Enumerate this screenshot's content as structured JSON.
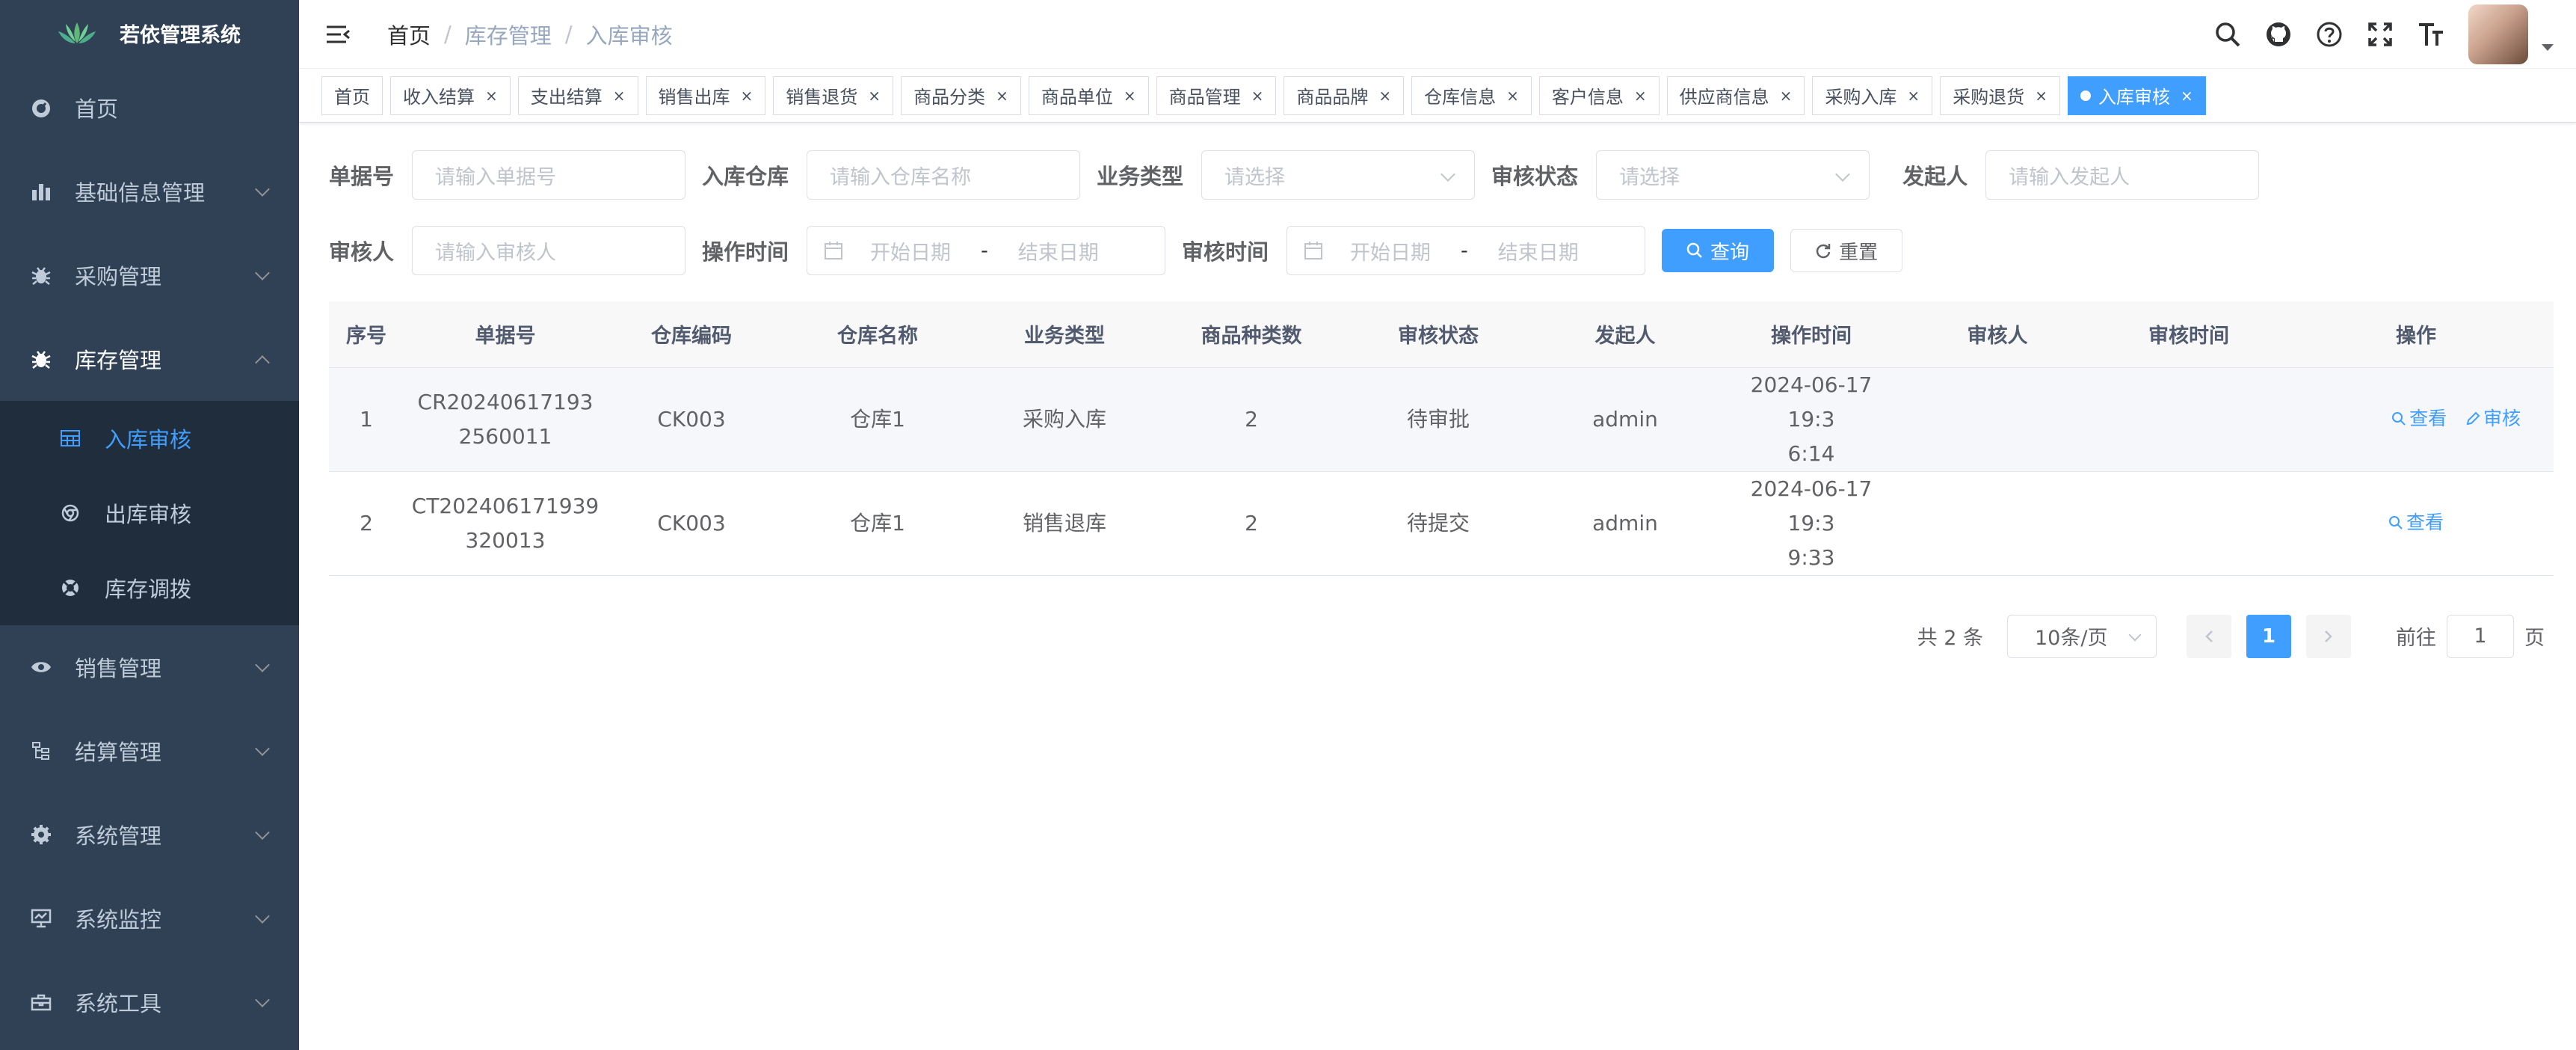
{
  "app": {
    "title": "若依管理系统"
  },
  "sidebar": {
    "items": [
      {
        "label": "首页",
        "icon": "dashboard-icon"
      },
      {
        "label": "基础信息管理",
        "icon": "chart-icon"
      },
      {
        "label": "采购管理",
        "icon": "bug-icon"
      },
      {
        "label": "库存管理",
        "icon": "bug-icon"
      },
      {
        "label": "销售管理",
        "icon": "eye-icon"
      },
      {
        "label": "结算管理",
        "icon": "tree-icon"
      },
      {
        "label": "系统管理",
        "icon": "gear-icon"
      },
      {
        "label": "系统监控",
        "icon": "monitor-icon"
      },
      {
        "label": "系统工具",
        "icon": "toolbox-icon"
      }
    ],
    "submenu": [
      {
        "label": "入库审核",
        "icon": "table-icon"
      },
      {
        "label": "出库审核",
        "icon": "chrome-icon"
      },
      {
        "label": "库存调拨",
        "icon": "lifebuoy-icon"
      }
    ]
  },
  "breadcrumb": {
    "home": "首页",
    "level1": "库存管理",
    "level2": "入库审核",
    "sep": "/"
  },
  "tags": [
    {
      "label": "首页",
      "closable": false
    },
    {
      "label": "收入结算",
      "closable": true
    },
    {
      "label": "支出结算",
      "closable": true
    },
    {
      "label": "销售出库",
      "closable": true
    },
    {
      "label": "销售退货",
      "closable": true
    },
    {
      "label": "商品分类",
      "closable": true
    },
    {
      "label": "商品单位",
      "closable": true
    },
    {
      "label": "商品管理",
      "closable": true
    },
    {
      "label": "商品品牌",
      "closable": true
    },
    {
      "label": "仓库信息",
      "closable": true
    },
    {
      "label": "客户信息",
      "closable": true
    },
    {
      "label": "供应商信息",
      "closable": true
    },
    {
      "label": "采购入库",
      "closable": true
    },
    {
      "label": "采购退货",
      "closable": true
    },
    {
      "label": "入库审核",
      "closable": true,
      "active": true
    }
  ],
  "tag_close": "×",
  "search": {
    "bill_no": {
      "label": "单据号",
      "placeholder": "请输入单据号"
    },
    "warehouse": {
      "label": "入库仓库",
      "placeholder": "请输入仓库名称"
    },
    "biz_type": {
      "label": "业务类型",
      "placeholder": "请选择"
    },
    "audit_status": {
      "label": "审核状态",
      "placeholder": "请选择"
    },
    "initiator": {
      "label": "发起人",
      "placeholder": "请输入发起人"
    },
    "auditor": {
      "label": "审核人",
      "placeholder": "请输入审核人"
    },
    "op_time": {
      "label": "操作时间",
      "start": "开始日期",
      "end": "结束日期"
    },
    "audit_time": {
      "label": "审核时间",
      "start": "开始日期",
      "end": "结束日期"
    },
    "date_sep": "-",
    "query_button": "查询",
    "reset_button": "重置"
  },
  "table": {
    "headers": [
      "序号",
      "单据号",
      "仓库编码",
      "仓库名称",
      "业务类型",
      "商品种类数",
      "审核状态",
      "发起人",
      "操作时间",
      "审核人",
      "审核时间",
      "操作"
    ],
    "rows": [
      {
        "index": "1",
        "bill_no_1": "CR20240617193",
        "bill_no_2": "2560011",
        "wh_code": "CK003",
        "wh_name": "仓库1",
        "biz_type": "采购入库",
        "kinds": "2",
        "status": "待审批",
        "initiator": "admin",
        "op_time_1": "2024-06-17 19:3",
        "op_time_2": "6:14",
        "auditor": "",
        "audit_time": "",
        "view": "查看",
        "audit": "审核"
      },
      {
        "index": "2",
        "bill_no_1": "CT202406171939",
        "bill_no_2": "320013",
        "wh_code": "CK003",
        "wh_name": "仓库1",
        "biz_type": "销售退库",
        "kinds": "2",
        "status": "待提交",
        "initiator": "admin",
        "op_time_1": "2024-06-17 19:3",
        "op_time_2": "9:33",
        "auditor": "",
        "audit_time": "",
        "view": "查看"
      }
    ]
  },
  "pagination": {
    "total_text": "共 2 条",
    "page_size": "10条/页",
    "current_page": "1",
    "goto_label": "前往",
    "goto_value": "1",
    "page_suffix": "页"
  },
  "colors": {
    "sidebar_bg": "#304156",
    "sidebar_sub_bg": "#1f2d3d",
    "accent": "#409eff"
  }
}
